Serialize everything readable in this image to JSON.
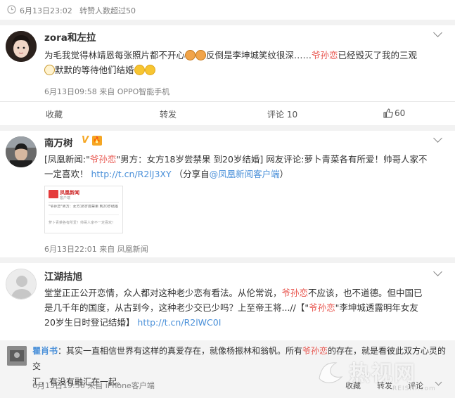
{
  "top_meta": {
    "timestamp": "6月13日23:02",
    "repost_note": "转赞人数超过50"
  },
  "posts": [
    {
      "username": "zora和左拉",
      "text_parts": {
        "a": "为毛我觉得林靖恩每张照片都不开心",
        "b": "反倒是李坤城笑纹很深……",
        "hl": "爷孙恋",
        "c": "已经毁灭了我的三观",
        "d": "默默的等待他们结婚"
      },
      "meta": "6月13日09:58 来自 OPPO智能手机",
      "actions": {
        "collect": "收藏",
        "repost": "转发",
        "comment": "评论 10",
        "like": "60"
      },
      "emojis": [
        "doge-face-icon",
        "mask-face-icon",
        "smile-face-icon"
      ]
    },
    {
      "username": "南万树",
      "badge_v": "V",
      "badge_member": "🔥",
      "text_parts": {
        "a": "[凤凰新闻:\"",
        "hl": "爷孙恋",
        "b": "\"男方：女方18岁尝禁果 到20岁结婚] 网友评论:萝卜青菜各有所爱！帅哥人家不",
        "c": "一定喜欢！",
        "link": "http://t.cn/R2lJ3XY",
        "d": "（分享自",
        "source_link": "@凤凰新闻客户端",
        "e": "）"
      },
      "card": {
        "brand": "凤凰新闻",
        "sub": "客户端",
        "headline": "\"爷孙恋\"男方：女方18岁尝禁果 到20岁结婚",
        "footer": "萝卜青菜各有所爱！帅哥人家不一定喜欢！"
      },
      "meta": "6月13日22:01 来自 凤凰新闻"
    },
    {
      "username": "江湖拮旭",
      "text_parts": {
        "a": "堂堂正正公开恋情，众人都对这种老少恋有看法。从伦常说，",
        "hl": "爷孙恋",
        "b": "不应该，也不道德。但中国已",
        "c": "是几千年的国度，从古到今，这种老少交已少吗？上至帝王将...//【\"",
        "hl2": "爷孙恋",
        "d": "\"李坤城透露明年女友",
        "e": "20岁生日时登记结婚】",
        "link": "http://t.cn/R2lWC0I"
      }
    }
  ],
  "reply": {
    "username": "瞿肖书",
    "text_a": "：其实一直相信世界有这样的真爱存在，就像杨振林和翁帆。所有",
    "hl": "爷孙恋",
    "text_b": "的存在，就是看彼此双方心灵的交",
    "text_c": "汇，有没有融汇在一起。",
    "meta": "6月13日19:56 来自 iPhone客户端",
    "actions": {
      "collect": "收藏",
      "repost": "转发",
      "comment": "评论"
    }
  },
  "watermark": {
    "text": "热视网",
    "sub": "REISHI.com"
  }
}
